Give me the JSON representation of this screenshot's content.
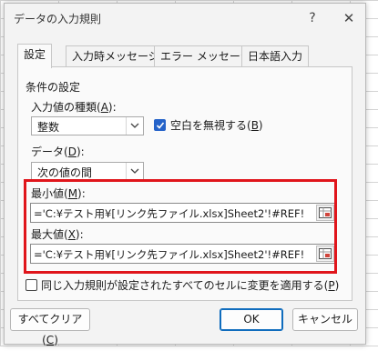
{
  "window": {
    "title": "データの入力規則",
    "help_glyph": "?",
    "close_glyph": "✕"
  },
  "tabs": [
    {
      "label": "設定",
      "active": true
    },
    {
      "label": "入力時メッセージ",
      "active": false
    },
    {
      "label": "エラー メッセージ",
      "active": false
    },
    {
      "label": "日本語入力",
      "active": false
    }
  ],
  "settings": {
    "group_label": "条件の設定",
    "allow_label": "入力値の種類(",
    "allow_key": "A",
    "allow_suffix": "):",
    "allow_value": "整数",
    "ignore_blank_label": "空白を無視する(",
    "ignore_blank_key": "B",
    "ignore_blank_suffix": ")",
    "ignore_blank_checked": true,
    "data_label": "データ(",
    "data_key": "D",
    "data_suffix": "):",
    "data_value": "次の値の間",
    "min_label": "最小値(",
    "min_key": "M",
    "min_suffix": "):",
    "min_value": "='C:¥テスト用¥[リンク先ファイル.xlsx]Sheet2'!#REF!",
    "max_label": "最大値(",
    "max_key": "X",
    "max_suffix": "):",
    "max_value": "='C:¥テスト用¥[リンク先ファイル.xlsx]Sheet2'!#REF!",
    "apply_all_label": "同じ入力規則が設定されたすべてのセルに変更を適用する(",
    "apply_all_key": "P",
    "apply_all_suffix": ")",
    "apply_all_checked": false
  },
  "buttons": {
    "clear_label": "すべてクリア(",
    "clear_key": "C",
    "clear_suffix": ")",
    "ok_label": "OK",
    "cancel_label": "キャンセル"
  },
  "colors": {
    "highlight": "#e0151b",
    "checkbox_accent": "#2563c9",
    "ok_border": "#0f6cbd"
  },
  "icons": [
    "help-icon",
    "close-icon",
    "chevron-down-icon",
    "check-icon",
    "range-select-icon"
  ]
}
